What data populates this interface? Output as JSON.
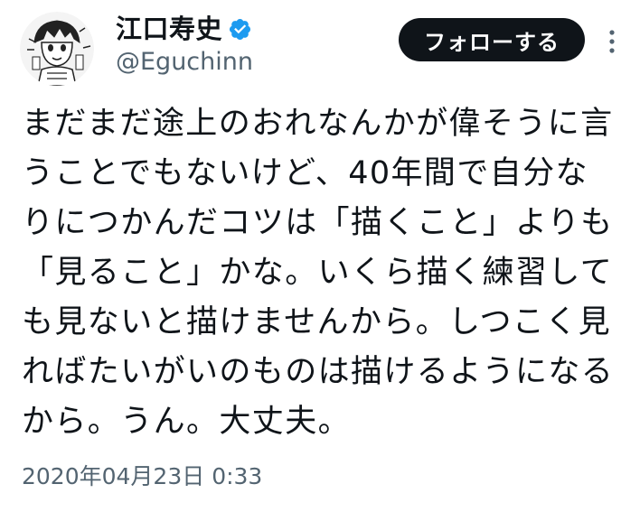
{
  "author": {
    "display_name": "江口寿史",
    "handle": "@Eguchinn",
    "verified": true,
    "avatar_icon": "manga-character-avatar",
    "verified_icon": "verified-badge-icon",
    "verified_color": "#1d9bf0"
  },
  "actions": {
    "follow_label": "フォローする",
    "more_icon": "more-options-icon"
  },
  "tweet": {
    "lines": [
      "まだまだ途上のおれなんかが偉そうに言",
      "うことでもないけど、40年間で自分な",
      "りにつかんだコツは「描くこと」よりも",
      "「見ること」かな。いくら描く練習して",
      "も見ないと描けませんから。しつこく見",
      "ればたいがいのものは描けるようになる",
      "から。うん。大丈夫。"
    ]
  },
  "timestamp": "2020年04月23日 0:33"
}
